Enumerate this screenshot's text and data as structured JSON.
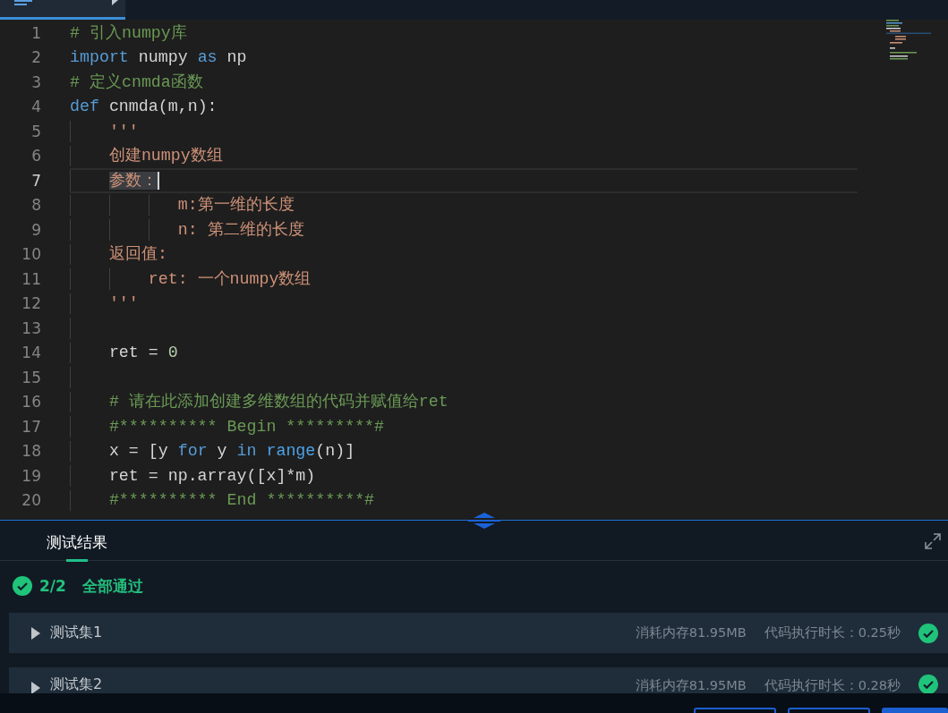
{
  "file_tab": {
    "selected": true
  },
  "editor": {
    "lines": [
      {
        "number": "1",
        "current": false,
        "tokens": [
          {
            "text": "# 引入numpy库",
            "kind": "comment"
          }
        ]
      },
      {
        "number": "2",
        "current": false,
        "tokens": [
          {
            "text": "import",
            "kind": "keyword"
          },
          {
            "text": " numpy ",
            "kind": "plain"
          },
          {
            "text": "as",
            "kind": "keyword"
          },
          {
            "text": " np",
            "kind": "plain"
          }
        ]
      },
      {
        "number": "3",
        "current": false,
        "tokens": [
          {
            "text": "# 定义cnmda函数",
            "kind": "comment"
          }
        ]
      },
      {
        "number": "4",
        "current": false,
        "tokens": [
          {
            "text": "def",
            "kind": "keyword"
          },
          {
            "text": " cnmda(m,n):",
            "kind": "plain"
          }
        ]
      },
      {
        "number": "5",
        "current": false,
        "tokens": [
          {
            "text": "    '''",
            "kind": "string"
          }
        ]
      },
      {
        "number": "6",
        "current": false,
        "tokens": [
          {
            "text": "    创建numpy数组",
            "kind": "string"
          }
        ]
      },
      {
        "number": "7",
        "current": true,
        "tokens": [
          {
            "text": "    参数：",
            "kind": "selected"
          }
        ]
      },
      {
        "number": "8",
        "current": false,
        "tokens": [
          {
            "text": "           m:第一维的长度",
            "kind": "string"
          }
        ]
      },
      {
        "number": "9",
        "current": false,
        "tokens": [
          {
            "text": "           n: 第二维的长度",
            "kind": "string"
          }
        ]
      },
      {
        "number": "10",
        "current": false,
        "tokens": [
          {
            "text": "    返回值:",
            "kind": "string"
          }
        ]
      },
      {
        "number": "11",
        "current": false,
        "tokens": [
          {
            "text": "        ret: 一个numpy数组",
            "kind": "string"
          }
        ]
      },
      {
        "number": "12",
        "current": false,
        "tokens": [
          {
            "text": "    '''",
            "kind": "string"
          }
        ]
      },
      {
        "number": "13",
        "current": false
      },
      {
        "number": "14",
        "current": false,
        "tokens": [
          {
            "text": "    ret = ",
            "kind": "plain"
          },
          {
            "text": "0",
            "kind": "number"
          }
        ]
      },
      {
        "number": "15",
        "current": false
      },
      {
        "number": "16",
        "current": false,
        "tokens": [
          {
            "text": "    # 请在此添加创建多维数组的代码并赋值给ret",
            "kind": "comment"
          }
        ]
      },
      {
        "number": "17",
        "current": false,
        "tokens": [
          {
            "text": "    #********** Begin *********#",
            "kind": "comment"
          }
        ]
      },
      {
        "number": "18",
        "current": false,
        "tokens": [
          {
            "text": "    x = [y ",
            "kind": "plain"
          },
          {
            "text": "for",
            "kind": "keyword"
          },
          {
            "text": " y ",
            "kind": "plain"
          },
          {
            "text": "in",
            "kind": "keyword"
          },
          {
            "text": " range",
            "kind": "builtin"
          },
          {
            "text": "(n)]",
            "kind": "plain"
          }
        ]
      },
      {
        "number": "19",
        "current": false,
        "tokens": [
          {
            "text": "    ret = np.array([x]*m)",
            "kind": "plain"
          }
        ]
      },
      {
        "number": "20",
        "current": false,
        "tokens": [
          {
            "text": "    #********** End **********#",
            "kind": "comment"
          }
        ]
      }
    ]
  },
  "results": {
    "tab": {
      "label": "测试结果",
      "selected": true
    },
    "summary": {
      "count": "2/2",
      "text": "全部通过",
      "passed": true
    },
    "tests": [
      {
        "name": "测试集1",
        "memory": "消耗内存81.95MB",
        "duration": "代码执行时长：0.25秒",
        "passed": true,
        "expanded": false
      },
      {
        "name": "测试集2",
        "memory": "消耗内存81.95MB",
        "duration": "代码执行时长：0.28秒",
        "passed": true,
        "expanded": false
      }
    ]
  },
  "footer_buttons": [
    {
      "kind": "outline"
    },
    {
      "kind": "outline"
    },
    {
      "kind": "primary"
    }
  ]
}
